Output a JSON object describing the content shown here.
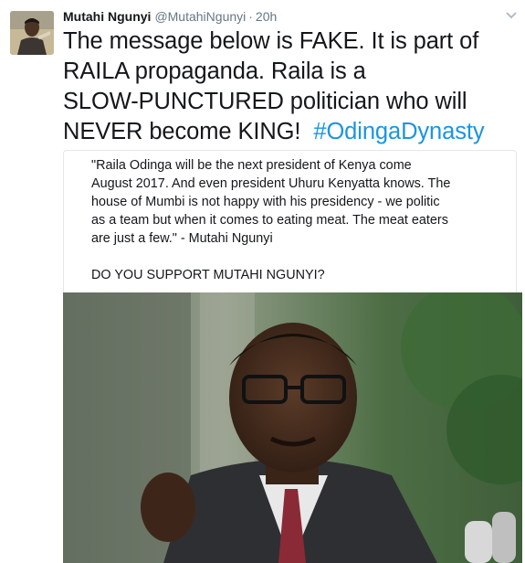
{
  "author": {
    "display_name": "Mutahi Ngunyi",
    "handle": "@MutahiNgunyi",
    "separator": "·",
    "time": "20h"
  },
  "tweet": {
    "lines": [
      "The message below is FAKE. It is part of",
      "RAILA propaganda. Raila is a",
      "SLOW-PUNCTURED politician who will",
      "NEVER become KING!"
    ],
    "hashtag": "#OdingaDynasty"
  },
  "quoted": {
    "lines": [
      "\"Raila Odinga will be the next president of Kenya come",
      "August 2017. And even president Uhuru Kenyatta knows. The",
      "house of Mumbi is not happy with his presidency - we politic",
      "as a team but when it comes to eating meat. The meat eaters",
      "are just a few.\" - Mutahi Ngunyi"
    ],
    "question": "DO YOU SUPPORT MUTAHI NGUNYI?"
  },
  "colors": {
    "hashtag": "#1b95e0",
    "muted": "#657786",
    "text": "#14171a",
    "border": "#e1e8ed"
  },
  "icons": [
    "avatar",
    "chevron-down-icon",
    "attached-photo"
  ]
}
